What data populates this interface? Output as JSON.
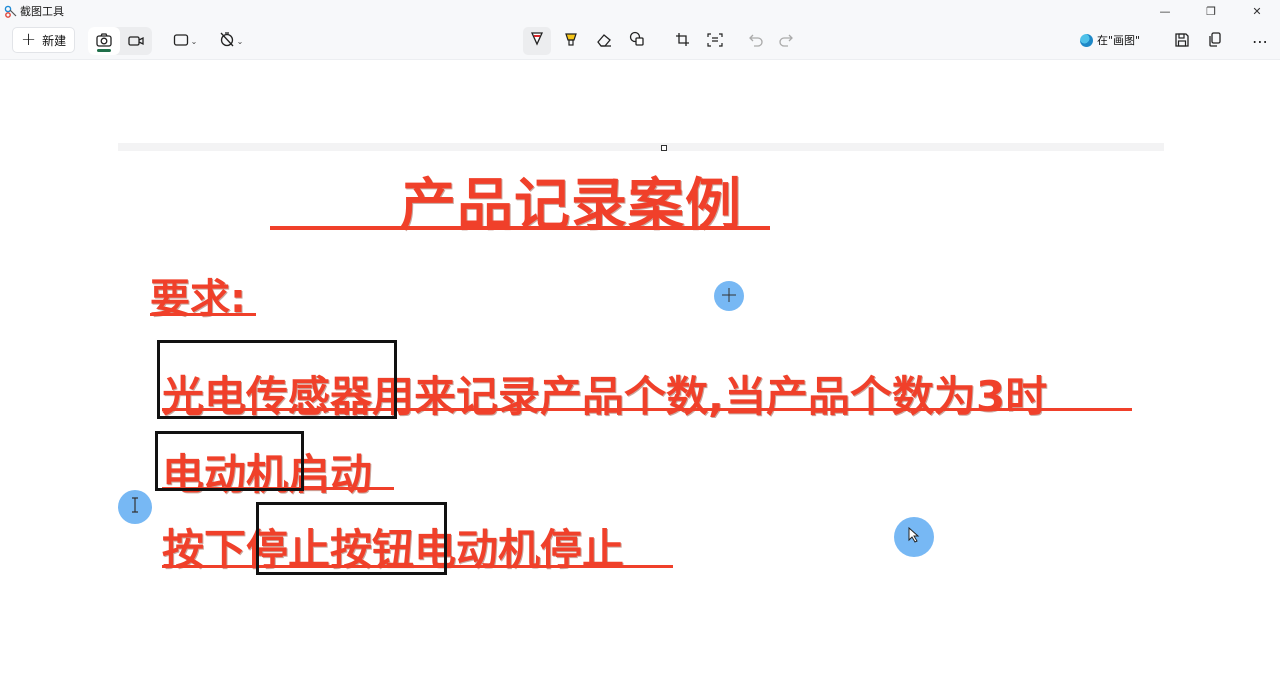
{
  "app": {
    "title": "截图工具"
  },
  "window_controls": {
    "minimize": "—",
    "restore": "❐",
    "close": "✕"
  },
  "toolbar": {
    "new_label": "新建",
    "open_in_label": "在\"画图\""
  },
  "slide": {
    "title": "产品记录案例",
    "requirement_label": "要求:",
    "line1_boxed": "光电传感器",
    "line1_rest": "用来记录产品个数,当产品个数为3时",
    "line2_boxed": "电动机",
    "line2_rest": "启动",
    "line3_prefix": "按下",
    "line3_boxed": "停止按钮",
    "line3_rest": "电动机停止"
  },
  "colors": {
    "accent_text": "#f0402a",
    "box_border": "#111111",
    "cursor_highlight": "#4aa0f0",
    "active_mode": "#1f6f4a"
  },
  "icons": [
    "snipping-tool-icon",
    "camera-icon",
    "video-icon",
    "rectangle-mode-icon",
    "timer-off-icon",
    "ballpoint-pen-icon",
    "highlighter-icon",
    "eraser-icon",
    "shapes-icon",
    "crop-icon",
    "text-actions-icon",
    "undo-icon",
    "redo-icon",
    "paint-icon",
    "save-icon",
    "copy-icon",
    "more-icon"
  ]
}
